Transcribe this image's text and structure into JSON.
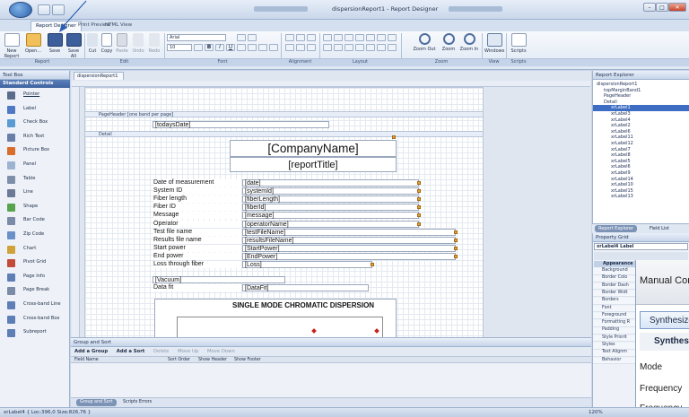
{
  "window": {
    "title": "dispersionReport1 - Report Designer"
  },
  "ribbon_tabs": [
    "Report Designer",
    "Print Preview",
    "HTML View"
  ],
  "ribbon": {
    "report_buttons": [
      "New Report",
      "Open...",
      "Save",
      "Save All"
    ],
    "edit_buttons": [
      "Cut",
      "Copy",
      "Paste",
      "Undo",
      "Redo"
    ],
    "font_name": "Arial",
    "font_size": "10",
    "zoom_buttons": [
      "Zoom Out",
      "Zoom",
      "Zoom In"
    ],
    "view_buttons": [
      "Windows",
      "Scripts"
    ],
    "group_labels": [
      "Report",
      "Edit",
      "Font",
      "Alignment",
      "Layout",
      "Zoom",
      "View",
      "Scripts"
    ]
  },
  "toolbox": {
    "title": "Tool Box",
    "section": "Standard Controls",
    "items": [
      "Pointer",
      "Label",
      "Check Box",
      "Rich Text",
      "Picture Box",
      "Panel",
      "Table",
      "Line",
      "Shape",
      "Bar Code",
      "Zip Code",
      "Chart",
      "Pivot Grid",
      "Page Info",
      "Page Break",
      "Cross-band Line",
      "Cross-band Box",
      "Subreport"
    ]
  },
  "designer": {
    "doc_tab": "dispersionReport1",
    "bands": {
      "page_header": "PageHeader [one band per page]",
      "detail": "Detail"
    },
    "page_header_field": "[todaysDate]",
    "company_name": "[CompanyName]",
    "report_title": "[reportTitle]",
    "rows": [
      {
        "label": "Date of measurement",
        "value": "[date]"
      },
      {
        "label": "System ID",
        "value": "[systemId]"
      },
      {
        "label": "Fiber length",
        "value": "[fiberLength]"
      },
      {
        "label": "Fiber ID",
        "value": "[fiberId]"
      },
      {
        "label": "Message",
        "value": "[message]"
      },
      {
        "label": "Operator",
        "value": "[operatorName]"
      },
      {
        "label": "Test file name",
        "value": "[testFileName]"
      },
      {
        "label": "Results file name",
        "value": "[resultsFileName]"
      },
      {
        "label": "Start power",
        "value": "[StartPower]"
      },
      {
        "label": "End power",
        "value": "[EndPower]"
      },
      {
        "label": "Loss through fiber",
        "value": "[Loss]"
      }
    ],
    "vacuum": "[Vacuum]",
    "data_fit_label": "Data fit",
    "data_fit_value": "[DataFit]",
    "chart_title": "SINGLE MODE CHROMATIC DISPERSION"
  },
  "group_sort": {
    "title": "Group and Sort",
    "toolbar": [
      "Add a Group",
      "Add a Sort",
      "Delete",
      "Move Up",
      "Move Down"
    ],
    "columns": [
      "Field Name",
      "Sort Order",
      "Show Header",
      "Show Footer"
    ],
    "bottom_tabs": [
      "Group and Sort",
      "Scripts Errors"
    ]
  },
  "report_explorer": {
    "title": "Report Explorer",
    "tree": [
      "dispersionReport1",
      "topMarginBand1",
      "PageHeader",
      "Detail",
      "xrLabel1",
      "xrLabel3",
      "xrLabel4",
      "xrLabel2",
      "xrLabel6",
      "xrLabel11",
      "xrLabel12",
      "xrLabel7",
      "xrLabel8",
      "xrLabel5",
      "xrLabel6",
      "xrLabel9",
      "xrLabel14",
      "xrLabel10",
      "xrLabel15",
      "xrLabel13"
    ],
    "tabs": [
      "Report Explorer",
      "Field List"
    ]
  },
  "property_grid": {
    "title": "Property Grid",
    "object": "xrLabel4 Label",
    "section": "Appearance",
    "rows": [
      "Background",
      "Border Colo",
      "Border Dash",
      "Border Widt",
      "Borders",
      "Font",
      "Foreground",
      "Formatting R",
      "Padding",
      "Style Priorit",
      "Styles",
      "Text Alignm",
      "Behavior"
    ]
  },
  "overlay": {
    "title": "Manual Control",
    "synth_tab": "Synthesizer",
    "synth_group": "Synthesizer",
    "labels": [
      "Mode",
      "Frequency",
      "Frequency"
    ]
  },
  "status": {
    "text": "xrLabel4 { Loc:396,0 Size:826,76 }",
    "zoom": "120%"
  }
}
